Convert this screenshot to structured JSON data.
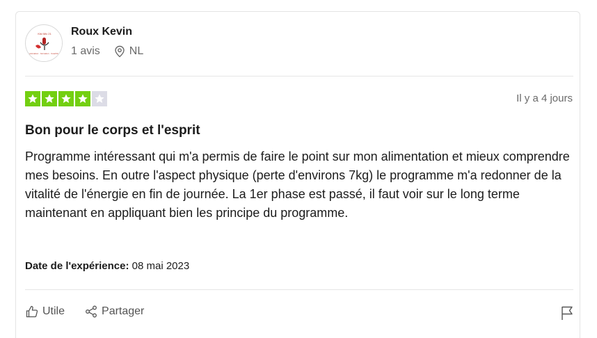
{
  "review": {
    "author": {
      "name": "Roux Kevin",
      "review_count": "1 avis",
      "country": "NL",
      "avatar_text_top": "Kiki Mix 21",
      "avatar_text_bottom": "animation · formation · Coaching"
    },
    "rating": 4,
    "rating_max": 5,
    "posted_ago": "Il y a 4 jours",
    "title": "Bon pour le corps et l'esprit",
    "text": "Programme intéressant qui m'a permis de faire le point sur mon alimentation et mieux comprendre mes besoins. En outre l'aspect physique (perte d'environs 7kg) le programme m'a redonner de la vitalité de l'énergie en fin de journée. La 1er phase est passé, il faut voir sur le long terme maintenant en appliquant bien les principe du programme.",
    "experience_label": "Date de l'expérience:",
    "experience_date": "08 mai 2023"
  },
  "actions": {
    "useful_label": "Utile",
    "share_label": "Partager"
  },
  "colors": {
    "star_on": "#73cf11",
    "star_off": "#dcdce6",
    "text": "#1c1c1c",
    "muted": "#6a6a6a"
  },
  "icons": [
    "map-pin-icon",
    "thumbs-up-icon",
    "share-icon",
    "flag-icon",
    "star-icon"
  ]
}
